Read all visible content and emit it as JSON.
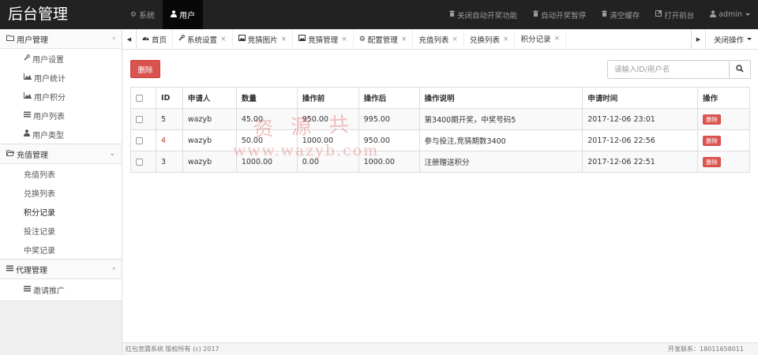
{
  "brand": "后台管理",
  "topnav": {
    "items": [
      {
        "label": "系统",
        "icon": "gear-icon"
      },
      {
        "label": "用户",
        "icon": "user-icon",
        "active": true
      }
    ],
    "right": [
      {
        "label": "关闭自动开奖功能",
        "icon": "trash-icon"
      },
      {
        "label": "自动开奖暂停",
        "icon": "trash-icon"
      },
      {
        "label": "清空缓存",
        "icon": "trash-icon"
      },
      {
        "label": "打开前台",
        "icon": "external-link-icon"
      },
      {
        "label": "admin",
        "icon": "user-icon"
      }
    ]
  },
  "sidebar": {
    "groups": [
      {
        "title": "用户管理",
        "items": [
          "用户设置",
          "用户统计",
          "用户积分",
          "用户列表",
          "用户类型"
        ]
      },
      {
        "title": "充值管理",
        "items": [
          "充值列表",
          "兑换列表",
          "积分记录",
          "投注记录",
          "中奖记录"
        ]
      },
      {
        "title": "代理管理",
        "items": [
          "邀请推广"
        ]
      }
    ]
  },
  "tabs": {
    "items": [
      {
        "label": "首页",
        "closable": false
      },
      {
        "label": "系统设置",
        "closable": true
      },
      {
        "label": "竞猜图片",
        "closable": true
      },
      {
        "label": "竞猜管理",
        "closable": true
      },
      {
        "label": "配置管理",
        "closable": true
      },
      {
        "label": "充值列表",
        "closable": true
      },
      {
        "label": "兑换列表",
        "closable": true
      },
      {
        "label": "积分记录",
        "closable": true,
        "active": true
      }
    ],
    "close_ops": "关闭操作"
  },
  "toolbar": {
    "delete_label": "删除",
    "search_placeholder": "请输入ID/用户名"
  },
  "table": {
    "headers": [
      "ID",
      "申请人",
      "数量",
      "操作前",
      "操作后",
      "操作说明",
      "申请时间",
      "操作"
    ],
    "rows": [
      {
        "id": "5",
        "user": "wazyb",
        "amount": "45.00",
        "before": "950.00",
        "after": "995.00",
        "desc": "第3400期开奖，中奖号码5",
        "time": "2017-12-06 23:01",
        "action": "删除"
      },
      {
        "id": "4",
        "user": "wazyb",
        "amount": "50.00",
        "before": "1000.00",
        "after": "950.00",
        "desc": "参与投注,竞猜期数3400",
        "time": "2017-12-06 22:56",
        "action": "删除"
      },
      {
        "id": "3",
        "user": "wazyb",
        "amount": "1000.00",
        "before": "0.00",
        "after": "1000.00",
        "desc": "注册赠送积分",
        "time": "2017-12-06 22:51",
        "action": "删除"
      }
    ]
  },
  "watermark": {
    "text": "资源共",
    "url": "www.wazyb.com"
  },
  "footer": {
    "copyright": "红包竞猜系统 版权所有 (c) 2017",
    "contact": "开发联系：18011658011"
  },
  "colors": {
    "danger": "#d9534f",
    "navbar": "#222222"
  }
}
